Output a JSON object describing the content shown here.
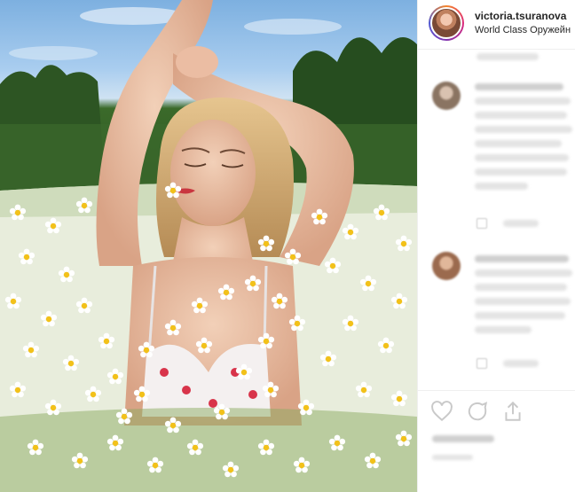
{
  "post": {
    "username": "victoria.tsuranova",
    "subtitle": "World Class Оружейн"
  },
  "icons": {
    "like": "heart-icon",
    "comment": "comment-bubble-icon",
    "share": "share-icon"
  },
  "colors": {
    "text": "#262626",
    "divider": "#efefef"
  }
}
